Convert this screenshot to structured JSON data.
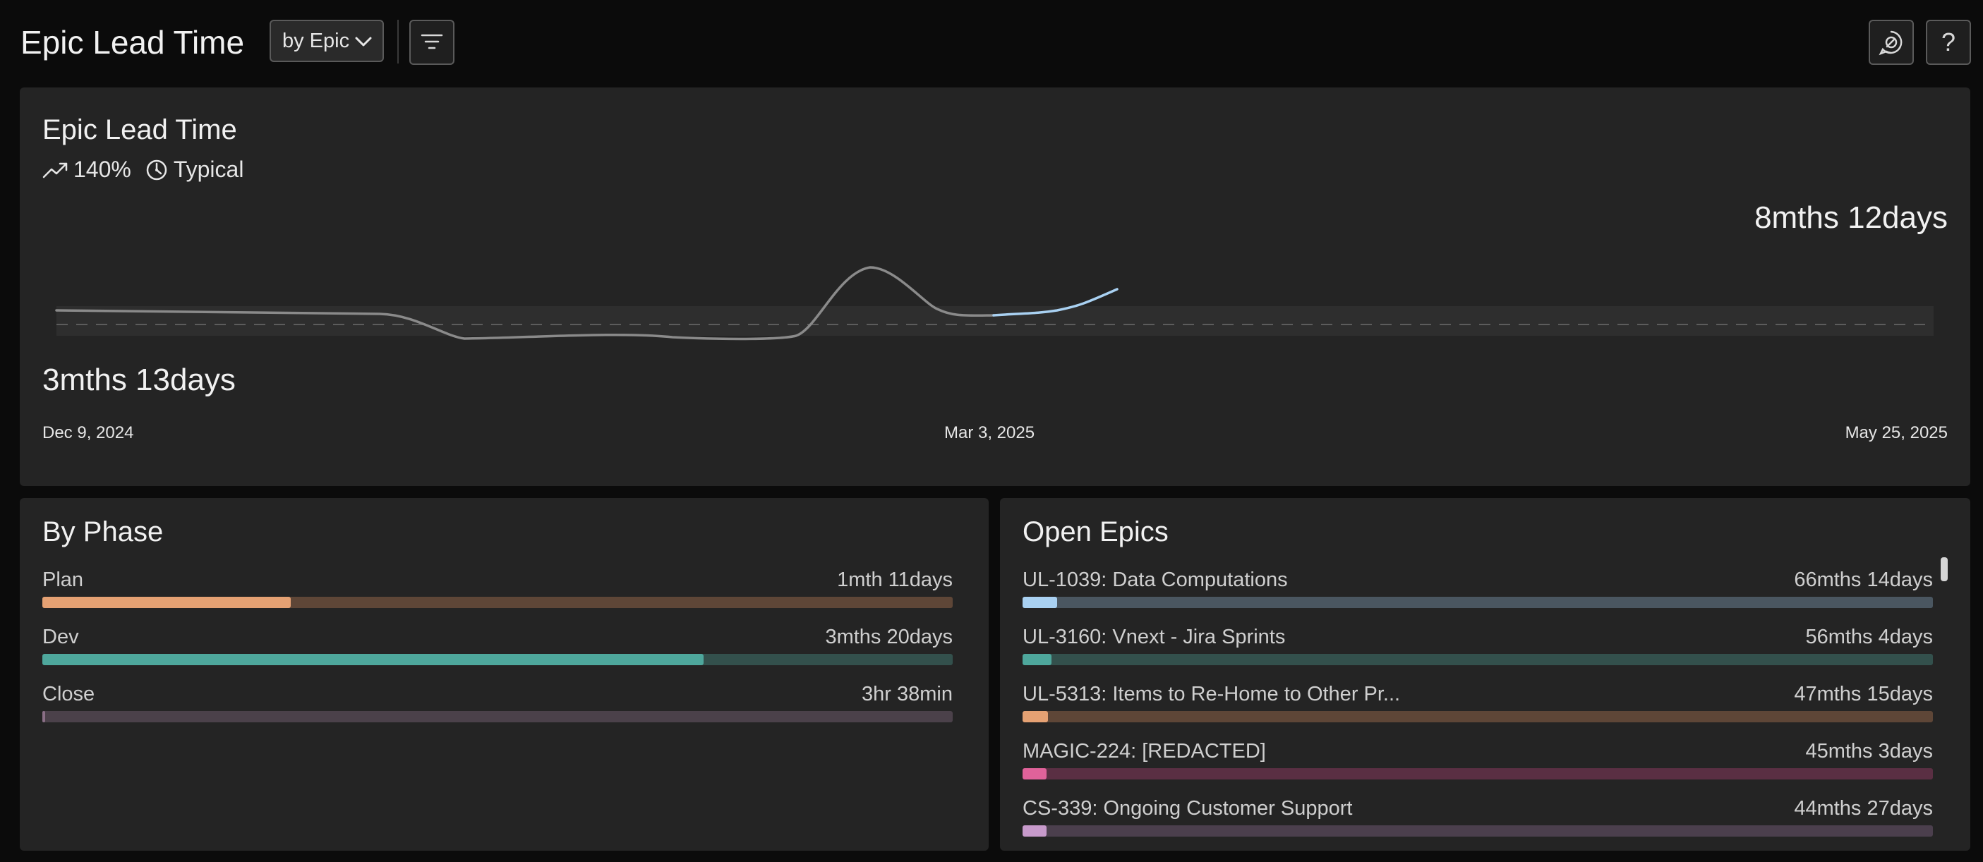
{
  "header": {
    "title": "Epic Lead Time",
    "view_select": "by Epic",
    "filter_icon": "filter-icon",
    "feedback_icon": "feedback-icon",
    "help_label": "?"
  },
  "lead_time_card": {
    "title": "Epic Lead Time",
    "trend_value": "140%",
    "trend_icon": "trending-up-icon",
    "status_icon": "gauge-icon",
    "status_label": "Typical",
    "max_label": "8mths 12days",
    "min_label": "3mths 13days",
    "dates": {
      "start": "Dec 9, 2024",
      "mid": "Mar 3, 2025",
      "end": "May 25, 2025"
    },
    "colors": {
      "history": "#8a8a8a",
      "recent": "#a9d1f2",
      "band": "#2e2e2e"
    }
  },
  "by_phase": {
    "title": "By Phase",
    "rows": [
      {
        "label": "Plan",
        "value": "1mth 11days",
        "fraction": 0.273,
        "color": "#e5a173",
        "track": "#5e4637"
      },
      {
        "label": "Dev",
        "value": "3mths 20days",
        "fraction": 0.726,
        "color": "#4ea79c",
        "track": "#33504c"
      },
      {
        "label": "Close",
        "value": "3hr 38min",
        "fraction": 0.003,
        "color": "#8a6f86",
        "track": "#4b414a"
      }
    ]
  },
  "open_epics": {
    "title": "Open Epics",
    "rows": [
      {
        "label": "UL-1039: Data Computations",
        "value": "66mths 14days",
        "fraction": 0.038,
        "color": "#a9d1f2",
        "track": "#4a5660"
      },
      {
        "label": "UL-3160: Vnext - Jira Sprints",
        "value": "56mths 4days",
        "fraction": 0.032,
        "color": "#4ea79c",
        "track": "#33504c"
      },
      {
        "label": "UL-5313: Items to Re-Home to Other Pr...",
        "value": "47mths 15days",
        "fraction": 0.028,
        "color": "#e5a173",
        "track": "#5e4637"
      },
      {
        "label": "MAGIC-224: [REDACTED]",
        "value": "45mths 3days",
        "fraction": 0.026,
        "color": "#e0629a",
        "track": "#5a2f43"
      },
      {
        "label": "CS-339: Ongoing Customer Support",
        "value": "44mths 27days",
        "fraction": 0.026,
        "color": "#c79acb",
        "track": "#4b3f4d"
      }
    ]
  }
}
